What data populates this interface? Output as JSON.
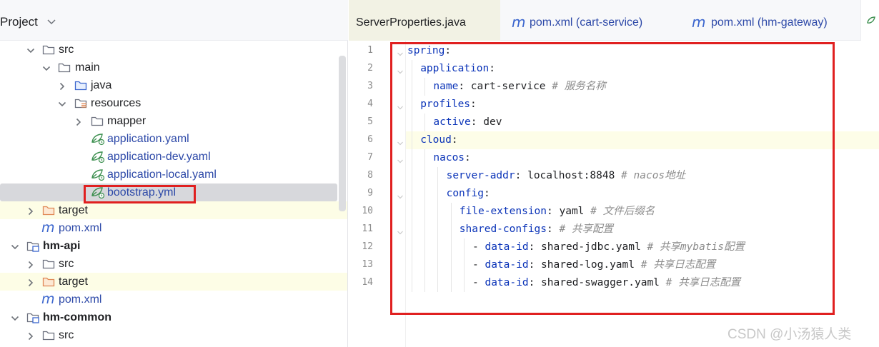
{
  "project": {
    "title": "Project",
    "tree": [
      {
        "label": "src",
        "type": "folder",
        "open": true
      },
      {
        "label": "main",
        "type": "folder",
        "open": true
      },
      {
        "label": "java",
        "type": "folder-blue",
        "open": false
      },
      {
        "label": "resources",
        "type": "folder-res",
        "open": true
      },
      {
        "label": "mapper",
        "type": "folder",
        "open": false
      },
      {
        "label": "application.yaml",
        "type": "yaml"
      },
      {
        "label": "application-dev.yaml",
        "type": "yaml"
      },
      {
        "label": "application-local.yaml",
        "type": "yaml"
      },
      {
        "label": "bootstrap.yml",
        "type": "yaml",
        "selected": true
      },
      {
        "label": "target",
        "type": "folder-orange",
        "open": false
      },
      {
        "label": "pom.xml",
        "type": "maven"
      },
      {
        "label": "hm-api",
        "type": "module",
        "open": true
      },
      {
        "label": "src",
        "type": "folder",
        "open": false
      },
      {
        "label": "target",
        "type": "folder-orange",
        "open": false
      },
      {
        "label": "pom.xml",
        "type": "maven"
      },
      {
        "label": "hm-common",
        "type": "module",
        "open": true
      },
      {
        "label": "src",
        "type": "folder",
        "open": false
      }
    ]
  },
  "tabs": [
    {
      "label": "ServerProperties.java",
      "active": true
    },
    {
      "label": "pom.xml (cart-service)",
      "icon": "m"
    },
    {
      "label": "pom.xml (hm-gateway)",
      "icon": "m"
    }
  ],
  "code": {
    "line_numbers": [
      "1",
      "2",
      "3",
      "4",
      "5",
      "6",
      "7",
      "8",
      "9",
      "10",
      "11",
      "12",
      "13",
      "14"
    ],
    "lines": [
      {
        "key": "spring",
        "sep": ":",
        "value": "",
        "comment": ""
      },
      {
        "key": "application",
        "sep": ":",
        "value": "",
        "comment": ""
      },
      {
        "key": "name",
        "sep": ": ",
        "value": "cart-service ",
        "comment": "# 服务名称"
      },
      {
        "key": "profiles",
        "sep": ":",
        "value": "",
        "comment": ""
      },
      {
        "key": "active",
        "sep": ": ",
        "value": "dev",
        "comment": ""
      },
      {
        "key": "cloud",
        "sep": ":",
        "value": "",
        "comment": ""
      },
      {
        "key": "nacos",
        "sep": ":",
        "value": "",
        "comment": ""
      },
      {
        "key": "server-addr",
        "sep": ": ",
        "value": "localhost:8848 ",
        "comment": "# nacos地址"
      },
      {
        "key": "config",
        "sep": ":",
        "value": "",
        "comment": ""
      },
      {
        "key": "file-extension",
        "sep": ": ",
        "value": "yaml ",
        "comment": "# 文件后缀名"
      },
      {
        "key": "shared-configs",
        "sep": ": ",
        "value": "",
        "comment": "# 共享配置"
      },
      {
        "dash": "- ",
        "key": "data-id",
        "sep": ": ",
        "value": "shared-jdbc.yaml ",
        "comment": "# 共享mybatis配置"
      },
      {
        "dash": "- ",
        "key": "data-id",
        "sep": ": ",
        "value": "shared-log.yaml ",
        "comment": "# 共享日志配置"
      },
      {
        "dash": "- ",
        "key": "data-id",
        "sep": ": ",
        "value": "shared-swagger.yaml ",
        "comment": "# 共享日志配置"
      }
    ]
  },
  "watermark": "CSDN @小汤猿人类"
}
